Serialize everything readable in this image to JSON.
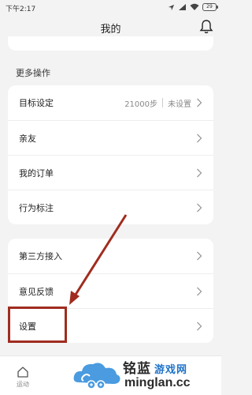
{
  "statusbar": {
    "time": "下午2:17",
    "battery": "29"
  },
  "header": {
    "title": "我的"
  },
  "section": {
    "title": "更多操作"
  },
  "card1": {
    "items": [
      {
        "label": "目标设定",
        "steps": "21000步",
        "status": "未设置"
      },
      {
        "label": "亲友"
      },
      {
        "label": "我的订单"
      },
      {
        "label": "行为标注"
      }
    ]
  },
  "card2": {
    "items": [
      {
        "label": "第三方接入"
      },
      {
        "label": "意见反馈"
      },
      {
        "label": "设置"
      }
    ]
  },
  "bottomnav": {
    "tab_label": "运动"
  },
  "watermark": {
    "brand": "铭蓝",
    "game": "游戏网",
    "url": "minglan.cc"
  },
  "colors": {
    "highlight": "#a02c1f",
    "background": "#f3f3f3",
    "card": "#ffffff"
  }
}
